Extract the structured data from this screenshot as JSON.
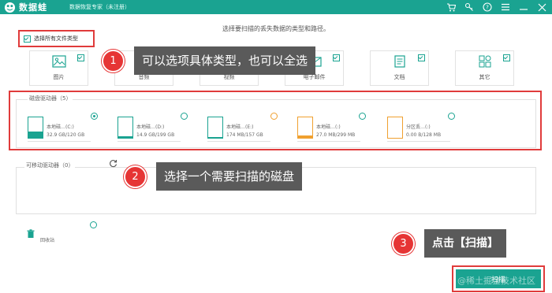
{
  "titlebar": {
    "app_name": "数据蛙",
    "subtitle": "数据恢复专家（未注册）",
    "icons": [
      "cart-icon",
      "key-icon",
      "help-icon",
      "menu-icon",
      "minimize-icon",
      "close-icon"
    ],
    "accent": "#1aa391"
  },
  "headline": "选择要扫描的丢失数据的类型和路径。",
  "select_all": {
    "label": "选择所有文件类型",
    "checked": true
  },
  "file_types": [
    {
      "label": "图片",
      "checked": true,
      "icon": "image-icon"
    },
    {
      "label": "音频",
      "checked": true,
      "icon": "audio-icon"
    },
    {
      "label": "视频",
      "checked": true,
      "icon": "video-icon"
    },
    {
      "label": "电子邮件",
      "checked": true,
      "icon": "email-icon"
    },
    {
      "label": "文档",
      "checked": true,
      "icon": "document-icon"
    },
    {
      "label": "其它",
      "checked": true,
      "icon": "other-icon"
    }
  ],
  "disks": {
    "title": "磁盘驱动器（5）",
    "items": [
      {
        "name": "本地磁…(C:)",
        "size": "32.9 GB/120 GB",
        "selected": true,
        "used_fraction": 0.27,
        "fill": "#1aa391"
      },
      {
        "name": "本地磁…(D:)",
        "size": "14.9 GB/199 GB",
        "selected": false,
        "used_fraction": 0.07,
        "fill": "#1aa391"
      },
      {
        "name": "本地磁…(E:)",
        "size": "174 MB/157 GB",
        "selected": false,
        "used_fraction": 0.01,
        "fill": "#1aa391"
      },
      {
        "name": "本地磁…(:)",
        "size": "27.0 MB/299 MB",
        "selected": false,
        "used_fraction": 0.09,
        "fill": "#f0a030"
      },
      {
        "name": "分区丢…(:)",
        "size": "0.00  B/128 MB",
        "selected": false,
        "used_fraction": 0.0,
        "fill": "#f0a030"
      }
    ]
  },
  "removable": {
    "title": "可移动驱动器（0）"
  },
  "recycle_bin": {
    "label": "回收站",
    "selected": false
  },
  "callouts": [
    {
      "number": "1",
      "text": "可以选项具体类型，也可以全选"
    },
    {
      "number": "2",
      "text": "选择一个需要扫描的磁盘"
    },
    {
      "number": "3",
      "text": "点击【扫描】"
    }
  ],
  "scan_button": {
    "label": "扫描"
  },
  "watermark": "@稀土掘金技术社区",
  "colors": {
    "highlight": "#e03b3b",
    "callout_bg": "#5a5a5a",
    "badge": "#e63535"
  }
}
